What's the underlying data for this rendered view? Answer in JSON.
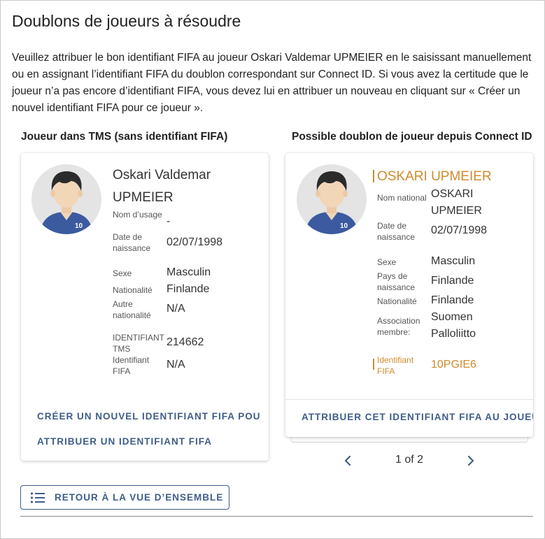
{
  "page": {
    "title": "Doublons de joueurs à résoudre",
    "intro": "Veuillez attribuer le bon identifiant FIFA au joueur Oskari Valdemar UPMEIER en le saisissant manuellement ou en assignant l’identifiant FIFA du doublon correspondant sur Connect ID. Si vous avez la certitude que le joueur n’a pas encore d’identifiant FIFA, vous devez lui en attribuer un nouveau en cliquant sur « Créer un nouvel identifiant FIFA pour ce joueur »."
  },
  "left": {
    "heading": "Joueur dans TMS (sans identifiant FIFA)",
    "avatar_number": "10",
    "name_line1": "Oskari Valdemar",
    "name_line2": "UPMEIER",
    "fields": {
      "usage_label": "Nom d’usage",
      "usage_value": "-",
      "birth_label": "Date de naissance",
      "birth_value": "02/07/1998",
      "sex_label": "Sexe",
      "sex_value": "Masculin",
      "nat_label": "Nationalité",
      "nat_value": "Finlande",
      "other_nat_label": "Autre nationalité",
      "other_nat_value": "N/A",
      "tms_label": "IDENTIFIANT TMS",
      "tms_value": "214662",
      "fifa_label": "Identifiant FIFA",
      "fifa_value": "N/A"
    },
    "actions": {
      "create": "CRÉER UN NOUVEL IDENTIFIANT FIFA POUR CE JOUEUR",
      "assign": "ATTRIBUER UN IDENTIFIANT FIFA"
    }
  },
  "right": {
    "heading": "Possible doublon de joueur depuis Connect ID",
    "avatar_number": "10",
    "name": "OSKARI UPMEIER",
    "fields": {
      "national_name_label": "Nom national",
      "national_name_line1": "OSKARI",
      "national_name_line2": "UPMEIER",
      "birth_label": "Date de naissance",
      "birth_value": "02/07/1998",
      "sex_label": "Sexe",
      "sex_value": "Masculin",
      "birth_country_label": "Pays de naissance",
      "birth_country_value": "Finlande",
      "nat_label": "Nationalité",
      "nat_value": "Finlande",
      "assoc_label": "Association membre:",
      "assoc_line1": "Suomen",
      "assoc_line2": "Palloliitto",
      "fifa_label": "Identifiant FIFA",
      "fifa_value": "10PGIE6"
    },
    "action": "ATTRIBUER CET IDENTIFIANT FIFA AU JOUEUR"
  },
  "pager": {
    "text": "1 of 2"
  },
  "back_button": {
    "label": "RETOUR À LA VUE D’ENSEMBLE"
  },
  "colors": {
    "accent": "#3f5d8a",
    "highlight": "#cf8b2e",
    "jersey": "#3b5aa0"
  },
  "icons": [
    "player-avatar-icon",
    "chevron-left-icon",
    "chevron-right-icon",
    "list-icon"
  ]
}
